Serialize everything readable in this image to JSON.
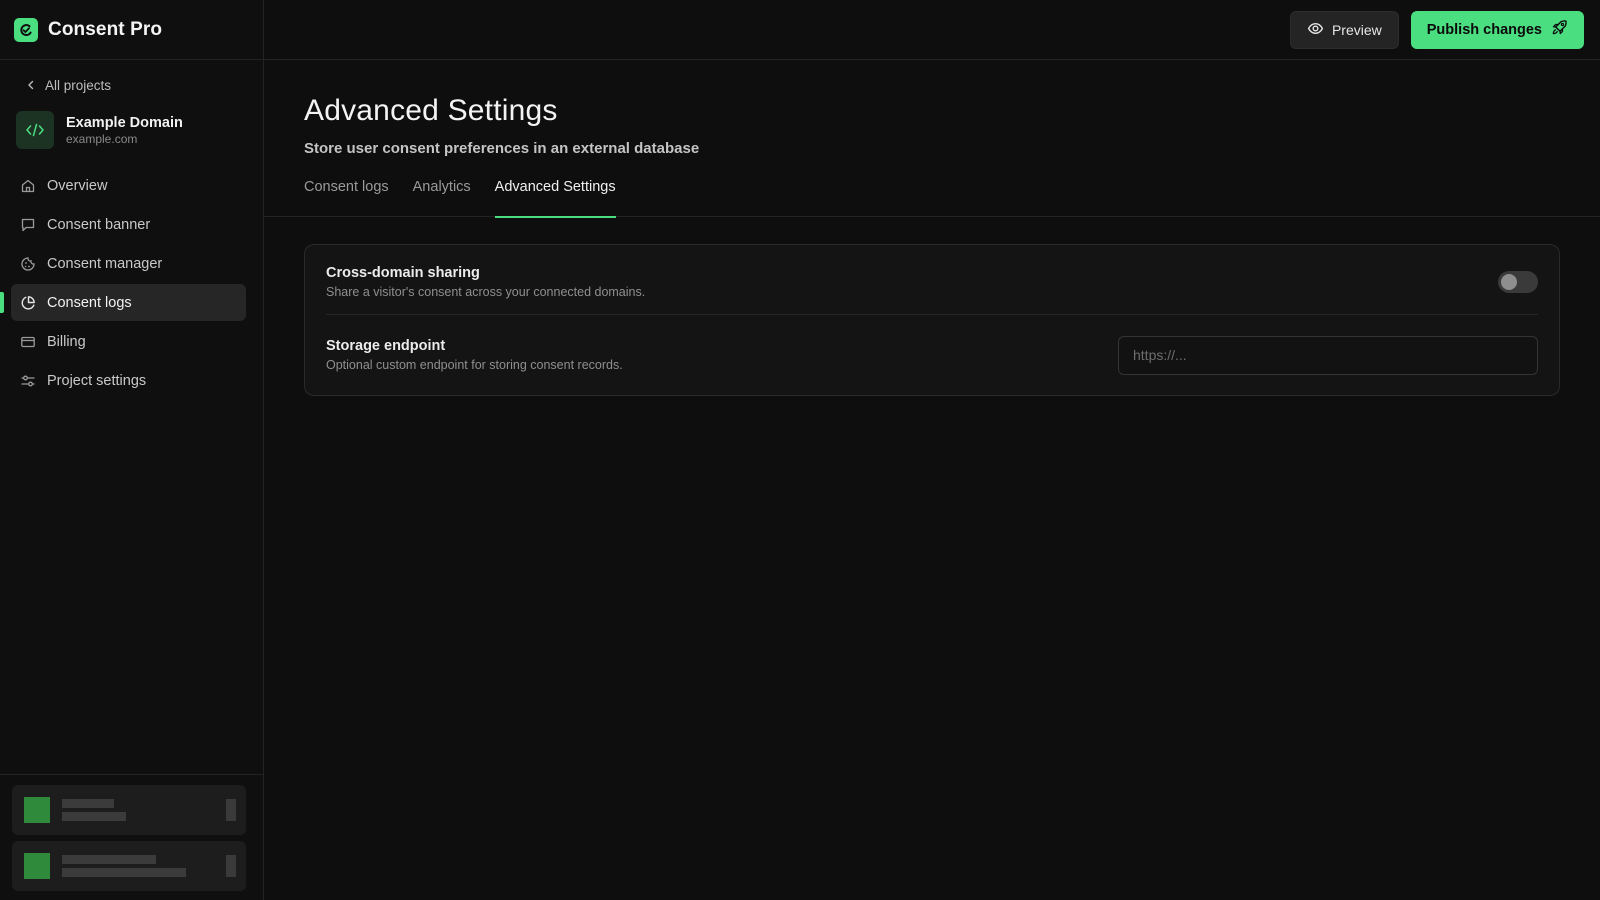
{
  "app": {
    "name": "Consent Pro",
    "accent_color": "#4ade80"
  },
  "sidebar": {
    "back_label": "All projects",
    "project": {
      "name": "Example Domain",
      "domain": "example.com"
    },
    "items": [
      {
        "label": "Overview",
        "icon": "home-icon"
      },
      {
        "label": "Consent banner",
        "icon": "message-square-icon"
      },
      {
        "label": "Consent manager",
        "icon": "cookie-icon"
      },
      {
        "label": "Consent logs",
        "icon": "pie-chart-icon",
        "active": true
      },
      {
        "label": "Billing",
        "icon": "credit-card-icon"
      },
      {
        "label": "Project settings",
        "icon": "sliders-icon"
      }
    ]
  },
  "topbar": {
    "preview_label": "Preview",
    "publish_label": "Publish changes"
  },
  "page": {
    "title": "Advanced Settings",
    "subtitle": "Store user consent preferences in an external database"
  },
  "tabs": [
    {
      "label": "Consent logs"
    },
    {
      "label": "Analytics"
    },
    {
      "label": "Advanced Settings",
      "active": true
    }
  ],
  "settings": {
    "cross_domain": {
      "title": "Cross-domain sharing",
      "description": "Share a visitor's consent across your connected domains.",
      "enabled": false
    },
    "storage_endpoint": {
      "title": "Storage endpoint",
      "description": "Optional custom endpoint for storing consent records.",
      "placeholder": "https://...",
      "value": ""
    }
  }
}
